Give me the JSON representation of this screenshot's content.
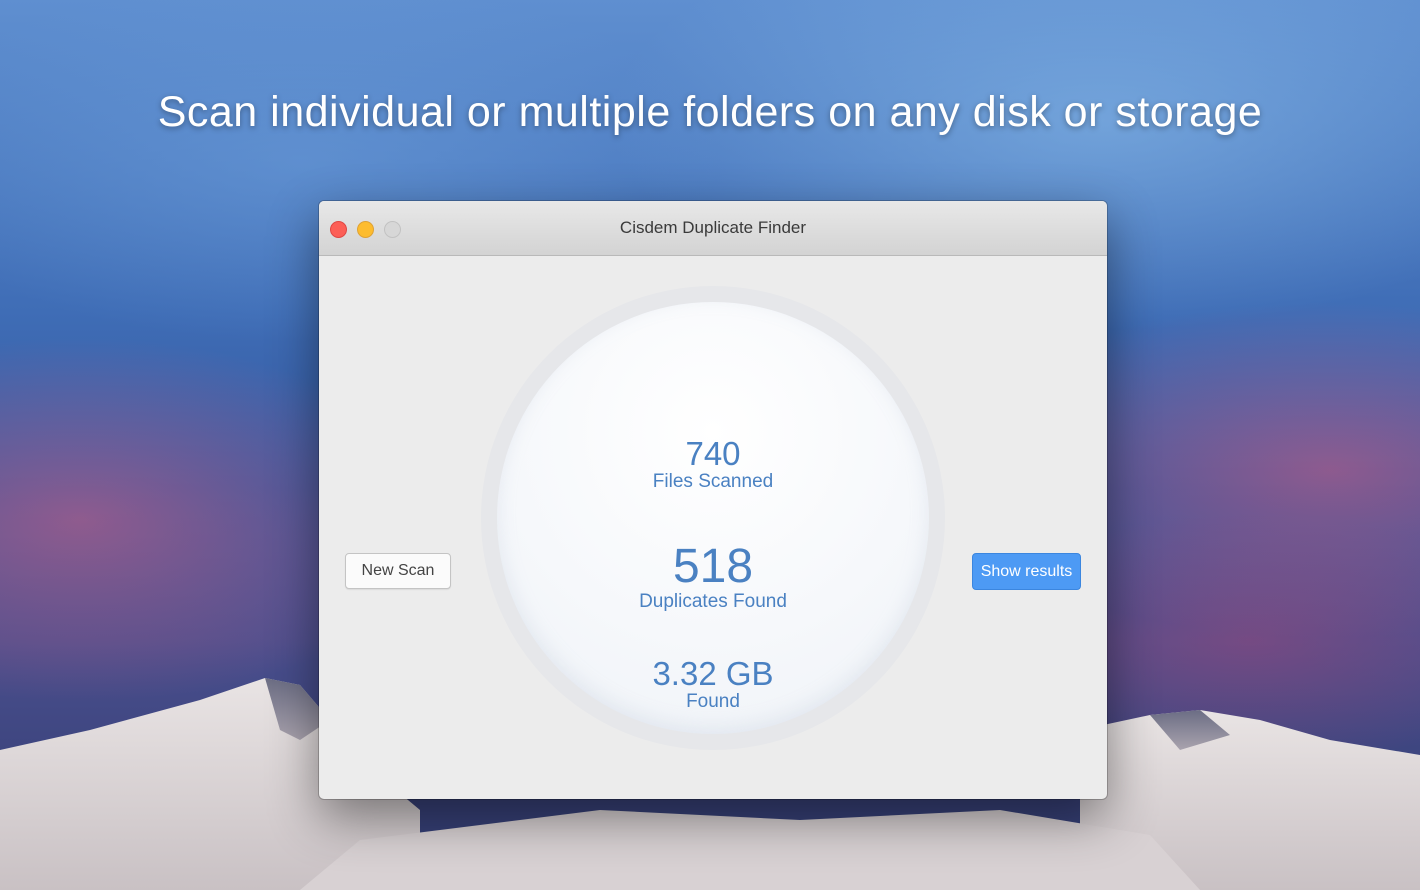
{
  "headline": "Scan individual or multiple folders on any disk or storage",
  "window": {
    "title": "Cisdem Duplicate Finder"
  },
  "stats": {
    "files_scanned_value": "740",
    "files_scanned_label": "Files Scanned",
    "duplicates_value": "518",
    "duplicates_label": "Duplicates Found",
    "size_value": "3.32 GB",
    "size_label": "Found"
  },
  "buttons": {
    "new_scan": "New Scan",
    "show_results": "Show results"
  },
  "icons": [
    "close-icon",
    "minimize-icon",
    "zoom-icon"
  ],
  "colors": {
    "accent": "#4d9af4",
    "stat_text": "#4a81c2"
  }
}
